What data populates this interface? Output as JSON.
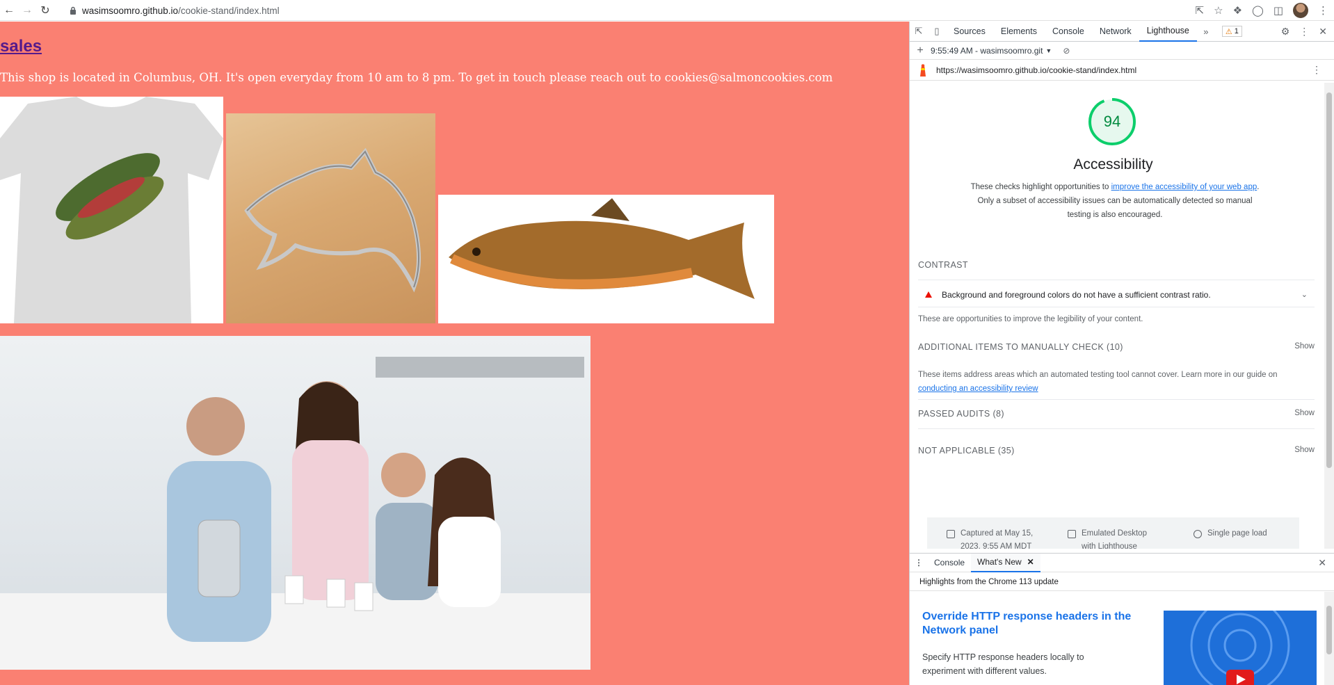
{
  "browser": {
    "url_host": "wasimsoomro.github.io",
    "url_path": "/cookie-stand/index.html"
  },
  "page": {
    "heading": "sales",
    "intro": "This shop is located in Columbus, OH. It's open everyday from 10 am to 8 pm. To get in touch please reach out to cookies@salmoncookies.com"
  },
  "devtools": {
    "tabs": [
      "Sources",
      "Elements",
      "Console",
      "Network",
      "Lighthouse"
    ],
    "active_tab": "Lighthouse",
    "warning_count": "1",
    "report_selector": "9:55:49 AM - wasimsoomro.git",
    "report_url": "https://wasimsoomro.github.io/cookie-stand/index.html",
    "score": "94",
    "category_title": "Accessibility",
    "desc_before": "These checks highlight opportunities to ",
    "desc_link": "improve the accessibility of your web app",
    "desc_after": ". Only a subset of accessibility issues can be automatically detected so manual testing is also encouraged.",
    "contrast_heading": "CONTRAST",
    "contrast_audit": "Background and foreground colors do not have a sufficient contrast ratio.",
    "contrast_note": "These are opportunities to improve the legibility of your content.",
    "manual_heading": "ADDITIONAL ITEMS TO MANUALLY CHECK (10)",
    "manual_note_before": "These items address areas which an automated testing tool cannot cover. Learn more in our guide on ",
    "manual_note_link": "conducting an accessibility review",
    "passed_heading": "PASSED AUDITS (8)",
    "na_heading": "NOT APPLICABLE (35)",
    "show_label": "Show",
    "captured": "Captured at May 15, 2023, 9:55 AM MDT",
    "emulated": "Emulated Desktop with Lighthouse",
    "single_page": "Single page load"
  },
  "drawer": {
    "tabs": [
      "Console",
      "What's New"
    ],
    "active_tab": "What's New",
    "highlights": "Highlights from the Chrome 113 update",
    "feature_title": "Override HTTP response headers in the Network panel",
    "feature_desc": "Specify HTTP response headers locally to experiment with different values."
  },
  "colors": {
    "page_background": "#fa8072",
    "heading_link": "#551a8b",
    "score_green": "#0cce6b",
    "link_blue": "#1a73e8",
    "fail_red": "#eb0f00"
  }
}
